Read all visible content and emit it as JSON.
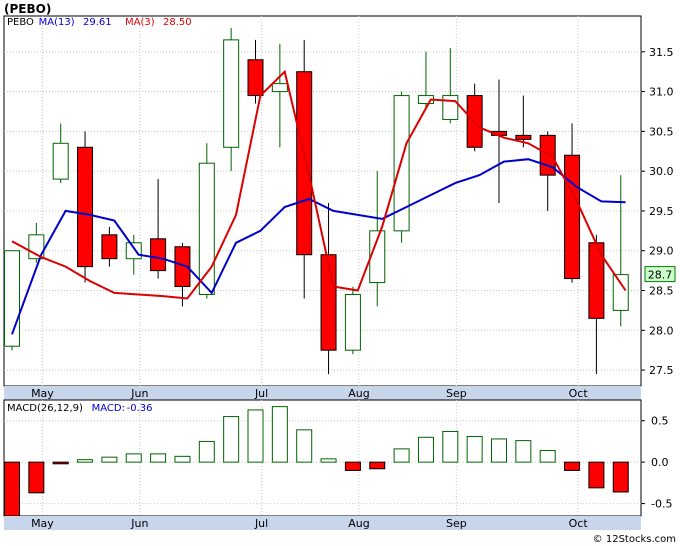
{
  "title": "(PEBO)",
  "watermark": "© 12Stocks.com",
  "colors": {
    "up_fill": "#ffffff",
    "up_stroke": "#006400",
    "down_fill": "#ff0000",
    "down_stroke": "#000000",
    "ma13": "#0000cc",
    "ma3": "#dd0000",
    "grid": "#c8c8c8",
    "axis_band": "#c8d6ec",
    "badge_fill": "#ccffcc",
    "badge_stroke": "#008000",
    "macd_bar_fill": "#ffffff",
    "macd_bar_up_stroke": "#006400",
    "macd_bar_down_fill": "#ff0000"
  },
  "chart_data": [
    {
      "type": "candlestick",
      "title": "(PEBO)",
      "legend": [
        {
          "label": "PEBO",
          "color": "#000000"
        },
        {
          "label": "MA(13)",
          "value": "29.61",
          "color": "#0000cc"
        },
        {
          "label": "MA(3)",
          "value": "28.50",
          "color": "#dd0000"
        }
      ],
      "ylim": [
        27.3,
        31.95
      ],
      "yticks": [
        27.5,
        28.0,
        28.5,
        29.0,
        29.5,
        30.0,
        30.5,
        31.0,
        31.5
      ],
      "ytick_labels": [
        "27.5",
        "28.0",
        "28.5",
        "29.0",
        "29.5",
        "30.0",
        "30.5",
        "31.0",
        "31.5"
      ],
      "xlabels": [
        {
          "label": "May",
          "i": 1.25
        },
        {
          "label": "Jun",
          "i": 5.25
        },
        {
          "label": "Jul",
          "i": 10.25
        },
        {
          "label": "Aug",
          "i": 14.25
        },
        {
          "label": "Sep",
          "i": 18.25
        },
        {
          "label": "Oct",
          "i": 23.25
        }
      ],
      "last_price_label": "28.7",
      "last_price": 28.7,
      "candles": [
        {
          "o": 27.8,
          "h": 29.0,
          "l": 27.75,
          "c": 29.0
        },
        {
          "o": 28.9,
          "h": 29.35,
          "l": 28.85,
          "c": 29.2
        },
        {
          "o": 29.9,
          "h": 30.6,
          "l": 29.85,
          "c": 30.35
        },
        {
          "o": 30.3,
          "h": 30.5,
          "l": 28.6,
          "c": 28.8
        },
        {
          "o": 29.2,
          "h": 29.3,
          "l": 28.8,
          "c": 28.9
        },
        {
          "o": 28.9,
          "h": 29.2,
          "l": 28.7,
          "c": 29.1
        },
        {
          "o": 29.15,
          "h": 29.9,
          "l": 28.65,
          "c": 28.75
        },
        {
          "o": 29.05,
          "h": 29.1,
          "l": 28.3,
          "c": 28.55
        },
        {
          "o": 28.45,
          "h": 30.35,
          "l": 28.4,
          "c": 30.1
        },
        {
          "o": 30.3,
          "h": 31.8,
          "l": 30.0,
          "c": 31.65
        },
        {
          "o": 31.4,
          "h": 31.65,
          "l": 30.85,
          "c": 30.95
        },
        {
          "o": 31.0,
          "h": 31.6,
          "l": 30.3,
          "c": 31.1
        },
        {
          "o": 31.25,
          "h": 31.65,
          "l": 28.4,
          "c": 28.95
        },
        {
          "o": 28.95,
          "h": 29.6,
          "l": 27.45,
          "c": 27.75
        },
        {
          "o": 27.75,
          "h": 28.55,
          "l": 27.7,
          "c": 28.45
        },
        {
          "o": 28.6,
          "h": 30.0,
          "l": 28.3,
          "c": 29.25
        },
        {
          "o": 29.25,
          "h": 31.0,
          "l": 29.1,
          "c": 30.95
        },
        {
          "o": 30.85,
          "h": 31.5,
          "l": 30.8,
          "c": 30.95
        },
        {
          "o": 30.65,
          "h": 31.55,
          "l": 30.6,
          "c": 30.95
        },
        {
          "o": 30.95,
          "h": 31.1,
          "l": 30.25,
          "c": 30.3
        },
        {
          "o": 30.5,
          "h": 31.15,
          "l": 29.6,
          "c": 30.45
        },
        {
          "o": 30.45,
          "h": 30.95,
          "l": 30.3,
          "c": 30.4
        },
        {
          "o": 30.45,
          "h": 30.5,
          "l": 29.5,
          "c": 29.95
        },
        {
          "o": 30.2,
          "h": 30.6,
          "l": 28.6,
          "c": 28.65
        },
        {
          "o": 29.1,
          "h": 29.2,
          "l": 27.45,
          "c": 28.15
        },
        {
          "o": 28.25,
          "h": 29.95,
          "l": 28.05,
          "c": 28.7
        }
      ],
      "ma13": [
        28.0,
        28.8,
        29.5,
        29.4,
        29.2,
        28.9,
        28.8,
        28.4,
        28.5,
        29.1,
        29.9,
        29.5,
        29.6,
        null,
        28.4,
        28.5,
        29.6,
        30.4,
        30.9,
        30.2,
        30.1,
        30.2,
        30.1,
        null,
        null,
        null
      ],
      "ma13_points": [
        {
          "i": 0,
          "v": 27.95
        },
        {
          "i": 1.5,
          "v": 28.9
        },
        {
          "i": 2.5,
          "v": 29.5
        },
        {
          "i": 4,
          "v": 29.4
        },
        {
          "i": 5.5,
          "v": 28.9
        },
        {
          "i": 6.5,
          "v": 28.85
        },
        {
          "i": 7.5,
          "v": 28.8
        },
        {
          "i": 8.2,
          "v": 28.45
        },
        {
          "i": 9.5,
          "v": 29.25
        },
        {
          "i": 10.3,
          "v": 30.95
        },
        {
          "i": 11.5,
          "v": 31.25
        },
        {
          "i": 12.2,
          "v": 29.9
        },
        {
          "i": 13.0,
          "v": 29.65
        },
        {
          "i": 13.6,
          "v": 28.55
        },
        {
          "i": 14.6,
          "v": 28.45
        },
        {
          "i": 15.3,
          "v": 29.55
        },
        {
          "i": 16.6,
          "v": 30.35
        },
        {
          "i": 17.4,
          "v": 30.45
        },
        {
          "i": 17.9,
          "v": 30.9
        },
        {
          "i": 18.8,
          "v": 30.55
        },
        {
          "i": 20.0,
          "v": 30.1
        },
        {
          "i": 21.3,
          "v": 30.15
        }
      ],
      "ma13_path": [
        {
          "i": 0.0,
          "v": 27.95
        },
        {
          "i": 1.3,
          "v": 28.95
        },
        {
          "i": 2.3,
          "v": 29.52
        },
        {
          "i": 3.3,
          "v": 29.45
        },
        {
          "i": 4.2,
          "v": 29.4
        },
        {
          "i": 5.2,
          "v": 28.95
        },
        {
          "i": 6.2,
          "v": 28.9
        },
        {
          "i": 7.3,
          "v": 28.8
        },
        {
          "i": 8.2,
          "v": 28.47
        },
        {
          "i": 9.3,
          "v": 29.25
        },
        {
          "i": 10.3,
          "v": 30.95
        },
        {
          "i": 11.3,
          "v": 31.25
        },
        {
          "i": 12.3,
          "v": 29.95
        },
        {
          "i": 13.3,
          "v": 28.55
        },
        {
          "i": 14.3,
          "v": 28.45
        },
        {
          "i": 15.3,
          "v": 29.55
        },
        {
          "i": 16.3,
          "v": 30.35
        },
        {
          "i": 17.3,
          "v": 30.4
        },
        {
          "i": 18.3,
          "v": 30.9
        },
        {
          "i": 19.3,
          "v": 30.55
        },
        {
          "i": 20.3,
          "v": 30.1
        },
        {
          "i": 21.3,
          "v": 30.15
        }
      ],
      "blue_line": [
        {
          "i": 0.0,
          "v": 27.95
        },
        {
          "i": 1.3,
          "v": 28.95
        },
        {
          "i": 2.3,
          "v": 29.52
        },
        {
          "i": 3.3,
          "v": 29.45
        },
        {
          "i": 4.2,
          "v": 29.4
        },
        {
          "i": 5.2,
          "v": 28.95
        },
        {
          "i": 6.2,
          "v": 28.9
        },
        {
          "i": 7.2,
          "v": 28.8
        },
        {
          "i": 8.2,
          "v": 28.47
        }
      ],
      "red_line": [
        {
          "i": 0.0,
          "v": 29.1
        },
        {
          "i": 1.0,
          "v": 28.9
        },
        {
          "i": 2.3,
          "v": 28.8
        },
        {
          "i": 4.3,
          "v": 28.47
        },
        {
          "i": 7.2,
          "v": 28.4
        },
        {
          "i": 8.2,
          "v": 28.47
        }
      ],
      "ma_blue": [
        {
          "i": 0.0,
          "v": 27.95
        },
        {
          "i": 1.3,
          "v": 28.9
        },
        {
          "i": 2.2,
          "v": 29.5
        },
        {
          "i": 3.3,
          "v": 29.45
        },
        {
          "i": 4.3,
          "v": 29.4
        },
        {
          "i": 5.3,
          "v": 28.95
        },
        {
          "i": 6.3,
          "v": 28.9
        },
        {
          "i": 7.3,
          "v": 28.8
        },
        {
          "i": 8.3,
          "v": 28.47
        },
        {
          "i": 9.3,
          "v": 29.1
        },
        {
          "i": 10.3,
          "v": 29.25
        },
        {
          "i": 11.3,
          "v": 29.55
        },
        {
          "i": 12.3,
          "v": 29.65
        }
      ],
      "ma_red": [
        {
          "i": 0.0,
          "v": 29.12
        },
        {
          "i": 1.3,
          "v": 28.9
        },
        {
          "i": 2.3,
          "v": 28.8
        },
        {
          "i": 4.3,
          "v": 28.47
        },
        {
          "i": 7.3,
          "v": 28.4
        }
      ],
      "ma13_series": [
        {
          "i": 0.0,
          "v": 27.95
        },
        {
          "i": 1.2,
          "v": 28.95
        },
        {
          "i": 2.2,
          "v": 29.5
        },
        {
          "i": 3.2,
          "v": 29.45
        },
        {
          "i": 4.2,
          "v": 29.38
        },
        {
          "i": 5.2,
          "v": 28.95
        },
        {
          "i": 6.2,
          "v": 28.9
        },
        {
          "i": 7.2,
          "v": 28.8
        },
        {
          "i": 8.2,
          "v": 28.47
        },
        {
          "i": 9.2,
          "v": 29.1
        },
        {
          "i": 10.2,
          "v": 29.25
        },
        {
          "i": 11.2,
          "v": 29.55
        },
        {
          "i": 12.2,
          "v": 29.65
        },
        {
          "i": 13.2,
          "v": 29.5
        },
        {
          "i": 14.2,
          "v": 29.45
        },
        {
          "i": 15.2,
          "v": 29.4
        },
        {
          "i": 16.2,
          "v": 29.55
        },
        {
          "i": 17.2,
          "v": 29.7
        },
        {
          "i": 18.2,
          "v": 29.85
        },
        {
          "i": 19.2,
          "v": 29.95
        },
        {
          "i": 20.2,
          "v": 30.12
        },
        {
          "i": 21.2,
          "v": 30.15
        },
        {
          "i": 22.2,
          "v": 30.05
        },
        {
          "i": 23.2,
          "v": 29.8
        },
        {
          "i": 24.2,
          "v": 29.62
        },
        {
          "i": 25.2,
          "v": 29.61
        }
      ],
      "ma3_series": [
        {
          "i": 0.0,
          "v": 29.12
        },
        {
          "i": 1.2,
          "v": 28.92
        },
        {
          "i": 2.2,
          "v": 28.8
        },
        {
          "i": 3.2,
          "v": 28.62
        },
        {
          "i": 4.2,
          "v": 28.47
        },
        {
          "i": 5.2,
          "v": 28.45
        },
        {
          "i": 6.2,
          "v": 28.43
        },
        {
          "i": 7.2,
          "v": 28.4
        },
        {
          "i": 8.2,
          "v": 28.8
        },
        {
          "i": 9.2,
          "v": 29.45
        },
        {
          "i": 10.2,
          "v": 30.95
        },
        {
          "i": 11.2,
          "v": 31.25
        },
        {
          "i": 12.2,
          "v": 29.95
        },
        {
          "i": 13.2,
          "v": 28.55
        },
        {
          "i": 14.2,
          "v": 28.5
        },
        {
          "i": 15.2,
          "v": 29.3
        },
        {
          "i": 16.2,
          "v": 30.35
        },
        {
          "i": 17.2,
          "v": 30.9
        },
        {
          "i": 18.2,
          "v": 30.88
        },
        {
          "i": 19.2,
          "v": 30.55
        },
        {
          "i": 20.2,
          "v": 30.42
        },
        {
          "i": 21.2,
          "v": 30.35
        },
        {
          "i": 22.2,
          "v": 30.18
        },
        {
          "i": 23.2,
          "v": 29.62
        },
        {
          "i": 24.2,
          "v": 28.95
        },
        {
          "i": 25.2,
          "v": 28.5
        }
      ]
    },
    {
      "type": "bar",
      "title": "MACD(26,12,9)",
      "legend": [
        {
          "label": "MACD(26,12,9)",
          "color": "#000000"
        },
        {
          "label": "MACD:",
          "value": "-0.36",
          "color": "#0000cc"
        }
      ],
      "ylim": [
        -0.65,
        0.75
      ],
      "yticks": [
        -0.5,
        0.0,
        0.5
      ],
      "ytick_labels": [
        "-0.5",
        "0.0",
        "0.5"
      ],
      "xlabels": [
        {
          "label": "May",
          "i": 1.25
        },
        {
          "label": "Jun",
          "i": 5.25
        },
        {
          "label": "Jul",
          "i": 10.25
        },
        {
          "label": "Aug",
          "i": 14.25
        },
        {
          "label": "Sep",
          "i": 18.25
        },
        {
          "label": "Oct",
          "i": 23.25
        }
      ],
      "values": [
        -0.65,
        -0.37,
        -0.02,
        0.03,
        0.06,
        0.1,
        0.1,
        0.07,
        0.25,
        0.55,
        0.63,
        0.67,
        0.39,
        0.04,
        -0.1,
        -0.08,
        0.16,
        0.3,
        0.37,
        0.31,
        0.28,
        0.26,
        0.14,
        -0.1,
        -0.31,
        -0.36
      ]
    }
  ]
}
